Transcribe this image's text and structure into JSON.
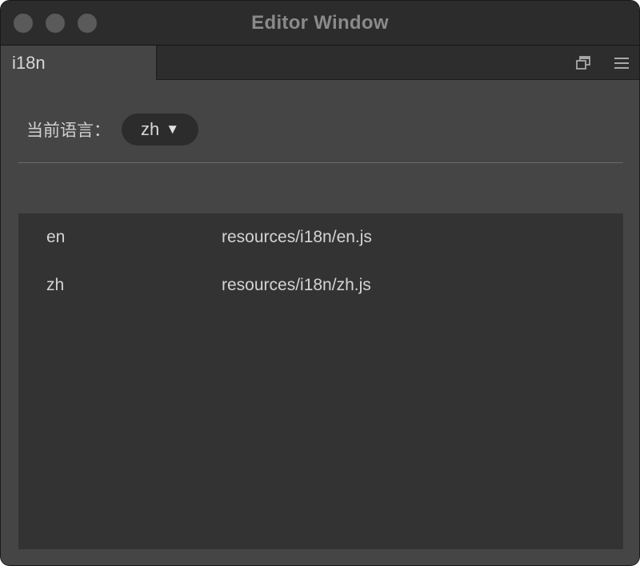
{
  "window": {
    "title": "Editor Window"
  },
  "tabs": [
    {
      "label": "i18n",
      "active": true
    }
  ],
  "tab_actions": {
    "popout_icon": "popout-window-icon",
    "menu_icon": "hamburger-menu-icon"
  },
  "language": {
    "label": "当前语言：",
    "selected": "zh",
    "caret": "▼"
  },
  "files": [
    {
      "code": "en",
      "path": "resources/i18n/en.js"
    },
    {
      "code": "zh",
      "path": "resources/i18n/zh.js"
    }
  ],
  "colors": {
    "window_bg": "#454545",
    "titlebar_bg": "#2c2c2c",
    "list_bg": "#333333",
    "text": "#d4d4d4"
  }
}
